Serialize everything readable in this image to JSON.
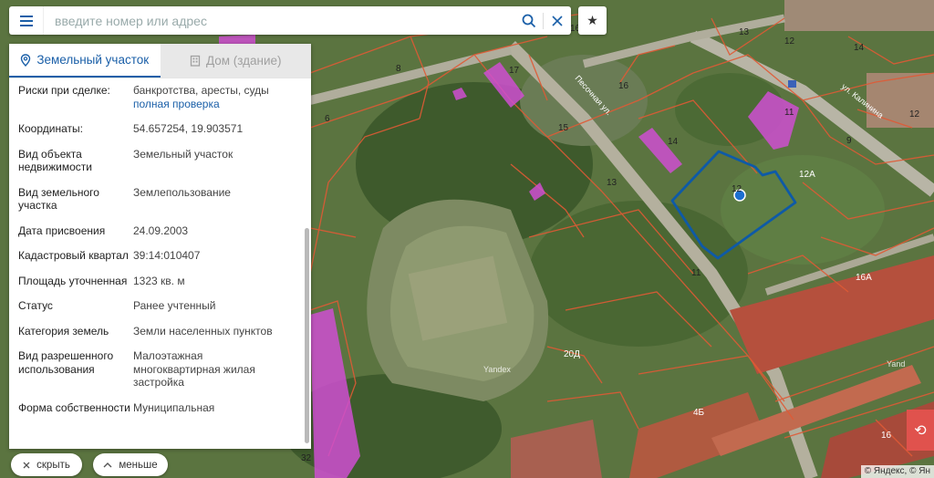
{
  "search": {
    "placeholder": "введите номер или адрес"
  },
  "icons": {
    "menu": "hamburger-icon",
    "search": "search-icon",
    "clear": "close-icon",
    "favorite": "star-icon",
    "land_tab": "map-pin-icon",
    "house_tab": "building-icon",
    "refresh": "refresh-icon"
  },
  "colors": {
    "accent": "#1a5fa8",
    "parcel_outline": "#0e5aa7",
    "building_highlight": "#d04ad0",
    "cadastral_lines": "#e05a35",
    "action_red": "#e0524d"
  },
  "tabs": [
    {
      "label": "Земельный участок",
      "active": true
    },
    {
      "label": "Дом (здание)",
      "active": false
    }
  ],
  "details": [
    {
      "key": "Риски при сделке:",
      "value": "банкротства, аресты, суды",
      "link": "полная проверка"
    },
    {
      "key": "Координаты:",
      "value": "54.657254, 19.903571"
    },
    {
      "key": "Вид объекта недвижимости",
      "value": "Земельный участок"
    },
    {
      "key": "Вид земельного участка",
      "value": "Землепользование"
    },
    {
      "key": "Дата присвоения",
      "value": "24.09.2003"
    },
    {
      "key": "Кадастровый квартал",
      "value": "39:14:010407"
    },
    {
      "key": "Площадь уточненная",
      "value": "1323 кв. м"
    },
    {
      "key": "Статус",
      "value": "Ранее учтенный"
    },
    {
      "key": "Категория земель",
      "value": "Земли населенных пунктов"
    },
    {
      "key": "Вид разрешенного использования",
      "value": "Малоэтажная многоквартирная жилая застройка"
    },
    {
      "key": "Форма собственности",
      "value": "Муниципальная"
    }
  ],
  "buttons": {
    "hide": "скрыть",
    "less": "меньше"
  },
  "map": {
    "streets": [
      "Песочная ул.",
      "ул. Калинина"
    ],
    "parcel_numbers": [
      "16",
      "13",
      "14",
      "12",
      "8",
      "17",
      "6",
      "16",
      "15",
      "14",
      "11",
      "12",
      "9",
      "13",
      "12",
      "12А",
      "11",
      "16А",
      "20Д",
      "4Б",
      "16",
      "32"
    ],
    "watermarks": [
      "Yandex",
      "Yand"
    ],
    "attribution": "© Яндекс, © Ян"
  }
}
